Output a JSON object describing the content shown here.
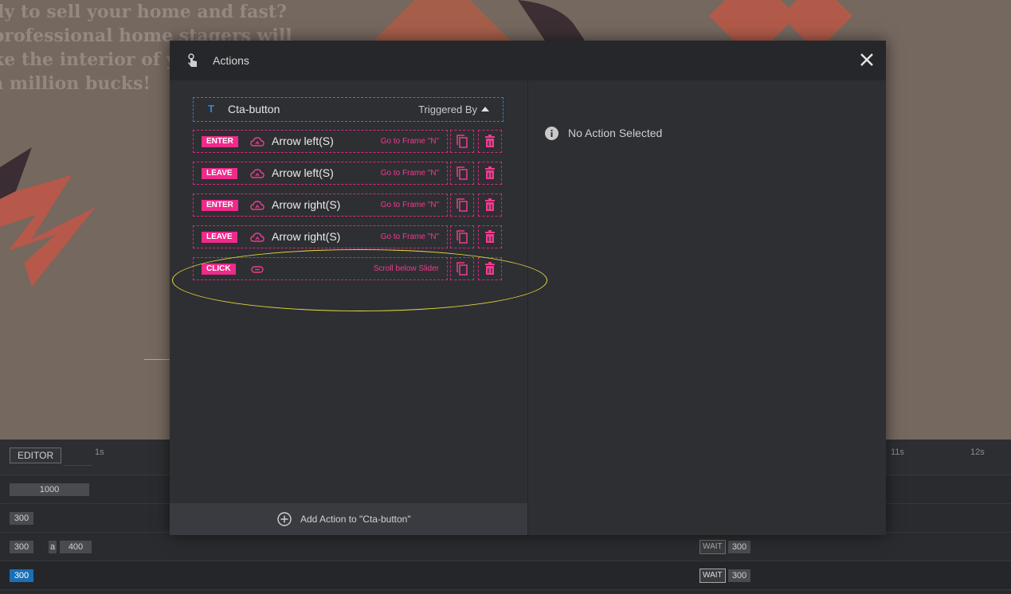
{
  "slide": {
    "lines": [
      "dy to sell your home and fast?",
      " professional home stagers will",
      "ke the interior of you",
      " a million bucks!"
    ]
  },
  "modal": {
    "title": "Actions",
    "title_icon": "touch-hand-icon",
    "close_icon": "close-icon",
    "trigger": {
      "layer_type": "T",
      "layer_name": "Cta-button",
      "triggered_by_label": "Triggered By"
    },
    "actions": [
      {
        "event": "ENTER",
        "icon": "cloud-icon",
        "target": "Arrow left(S)",
        "description": "Go to Frame \"N\""
      },
      {
        "event": "LEAVE",
        "icon": "cloud-icon",
        "target": "Arrow left(S)",
        "description": "Go to Frame \"N\""
      },
      {
        "event": "ENTER",
        "icon": "cloud-icon",
        "target": "Arrow right(S)",
        "description": "Go to Frame \"N\""
      },
      {
        "event": "LEAVE",
        "icon": "cloud-icon",
        "target": "Arrow right(S)",
        "description": "Go to Frame \"N\""
      },
      {
        "event": "CLICK",
        "icon": "link-icon",
        "target": "",
        "description": "Scroll below Slider"
      }
    ],
    "add_action_label": "Add Action to \"Cta-button\"",
    "no_action_label": "No Action Selected"
  },
  "timeline": {
    "editor_label": "EDITOR",
    "ticks": [
      "1s",
      "11s",
      "12s"
    ],
    "rows": [
      {
        "values": [
          "1000"
        ]
      },
      {
        "values": [
          "300"
        ]
      },
      {
        "values": [
          "300",
          "a",
          "400"
        ],
        "wait_label": "WAIT",
        "wait_value": "300"
      },
      {
        "values": [
          "300"
        ],
        "wait_label": "WAIT",
        "wait_value": "300"
      }
    ]
  },
  "colors": {
    "accent_pink": "#ee2a8b",
    "accent_blue": "#2a7fd0",
    "modal_bg": "#2e2f33",
    "highlight": "#e8dc3a"
  }
}
